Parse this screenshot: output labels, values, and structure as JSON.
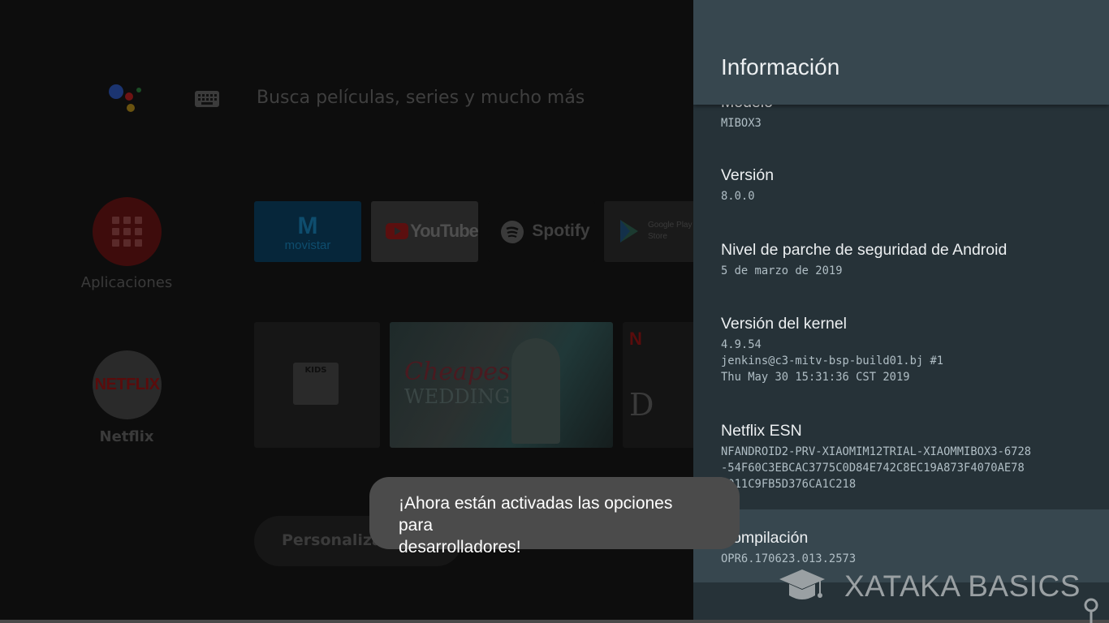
{
  "launcher": {
    "search_placeholder": "Busca películas, series y mucho más",
    "apps_label": "Aplicaciones",
    "netflix_label": "Netflix",
    "netflix_logo": "NETFLIX",
    "customize_label": "Personalizar canales",
    "tiles": {
      "movistar": "movistar",
      "youtube": "YouTube",
      "spotify": "Spotify",
      "play_line1": "Google Play",
      "play_line2": "Store",
      "kids": "KIDS",
      "cheapest": "Cheapest",
      "weddings": "WEDDINGS",
      "d_letter": "D"
    }
  },
  "panel": {
    "title": "Información",
    "items": [
      {
        "label": "Modelo",
        "value_lines": [
          "MIBOX3"
        ]
      },
      {
        "label": "Versión",
        "value_lines": [
          "8.0.0"
        ]
      },
      {
        "label": "Nivel de parche de seguridad de Android",
        "value_lines": [
          "5 de marzo de 2019"
        ]
      },
      {
        "label": "Versión del kernel",
        "value_lines": [
          "4.9.54",
          "jenkins@c3-mitv-bsp-build01.bj #1",
          "Thu May 30 15:31:36 CST 2019"
        ]
      },
      {
        "label": "Netflix ESN",
        "value_lines": [
          "NFANDROID2-PRV-XIAOMIM12TRIAL-XIAOMMIBOX3-6728",
          "-54F60C3EBCAC3775C0D84E742C8EC19A873F4070AE78",
          "9011C9FB5D376CA1C218"
        ]
      },
      {
        "label": "Compilación",
        "value_lines": [
          "OPR6.170623.013.2573"
        ]
      }
    ]
  },
  "toast": {
    "line1": "¡Ahora están activadas las opciones para",
    "line2": "desarrolladores!"
  },
  "watermark": {
    "text": "XATAKA BASICS"
  },
  "colors": {
    "panel_bg": "#263238",
    "panel_header": "#37474f",
    "selected_item": "#37474f",
    "toast_bg": "#4b4b4b"
  },
  "icons": [
    "assistant-icon",
    "keyboard-icon",
    "apps-grid-icon",
    "graduation-cap-icon",
    "pin-icon"
  ]
}
